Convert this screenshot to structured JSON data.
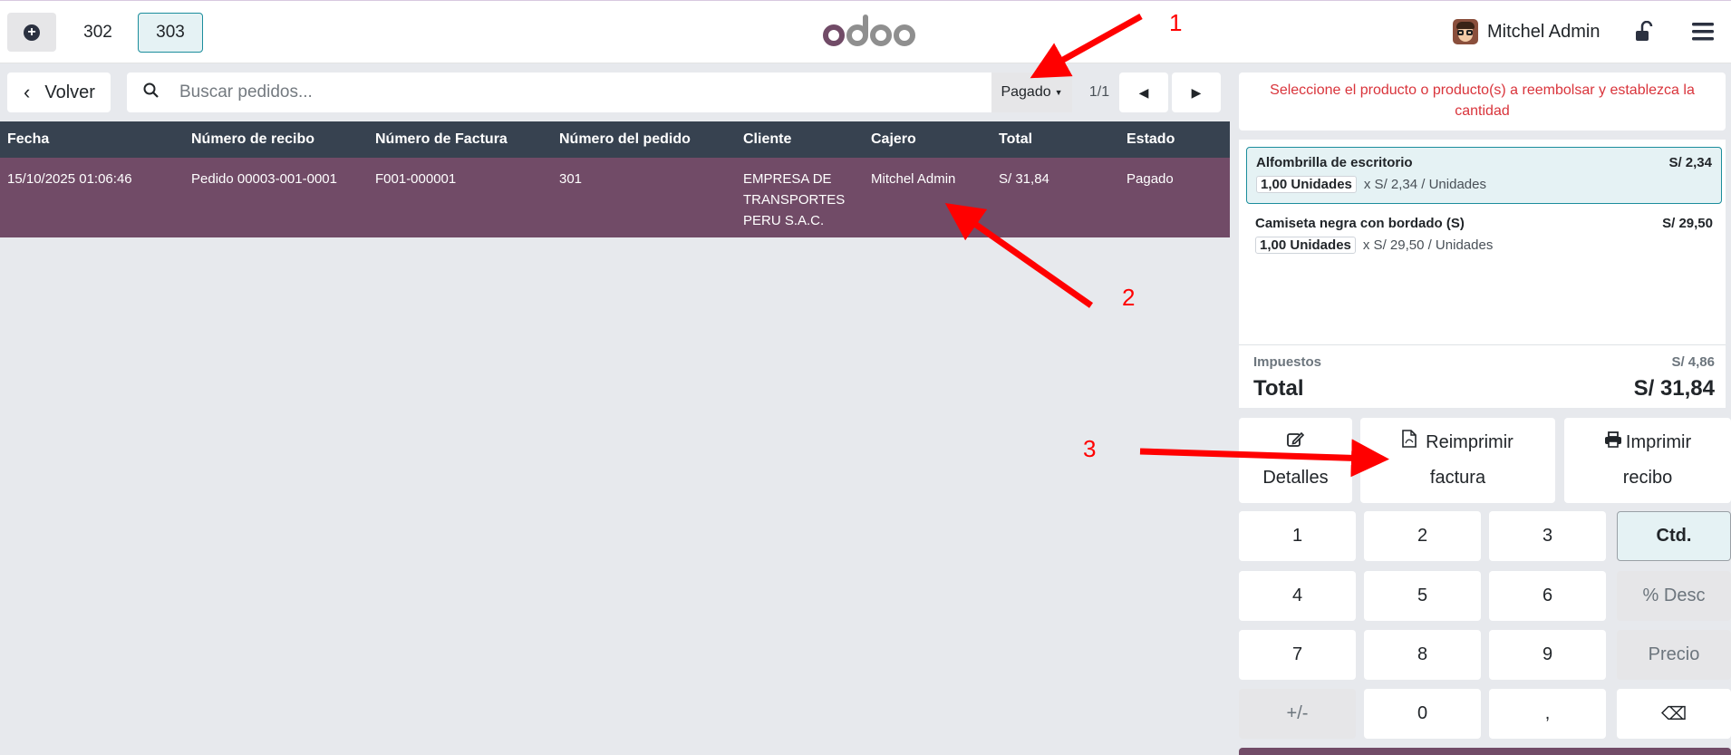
{
  "topbar": {
    "order_tabs": [
      "302",
      "303"
    ],
    "user_name": "Mitchel Admin"
  },
  "toolbar": {
    "back_label": "Volver",
    "search_placeholder": "Buscar pedidos...",
    "filter_label": "Pagado",
    "pager": "1/1"
  },
  "table": {
    "columns": [
      "Fecha",
      "Número de recibo",
      "Número de Factura",
      "Número del pedido",
      "Cliente",
      "Cajero",
      "Total",
      "Estado"
    ],
    "rows": [
      {
        "date": "15/10/2025 01:06:46",
        "receipt": "Pedido 00003-001-0001",
        "invoice": "F001-000001",
        "order": "301",
        "client": "EMPRESA DE TRANSPORTES PERU S.A.C.",
        "cashier": "Mitchel Admin",
        "total": "S/ 31,84",
        "status": "Pagado"
      }
    ]
  },
  "refund": {
    "notice": "Seleccione el producto o producto(s) a reembolsar y establezca la cantidad",
    "lines": [
      {
        "name": "Alfombrilla de escritorio",
        "price": "S/ 2,34",
        "qty": "1,00 Unidades",
        "unit": "x S/ 2,34 / Unidades"
      },
      {
        "name": "Camiseta negra con bordado (S)",
        "price": "S/ 29,50",
        "qty": "1,00 Unidades",
        "unit": "x S/ 29,50 / Unidades"
      }
    ],
    "tax_label": "Impuestos",
    "tax_value": "S/ 4,86",
    "total_label": "Total",
    "total_value": "S/ 31,84"
  },
  "actions": {
    "details": "Detalles",
    "reprint_invoice_1": "Reimprimir",
    "reprint_invoice_2": "factura",
    "print_receipt_1": "Imprimir",
    "print_receipt_2": "recibo"
  },
  "numpad": {
    "keys": [
      "1",
      "2",
      "3",
      "Ctd.",
      "4",
      "5",
      "6",
      "% Desc",
      "7",
      "8",
      "9",
      "Precio",
      "+/-",
      "0",
      ",",
      "⌫"
    ]
  },
  "annotations": [
    "1",
    "2",
    "3"
  ],
  "colors": {
    "brand": "#714b67",
    "header": "#374250",
    "accent": "#1b8d9c",
    "annotation": "#ff0000",
    "notice_text": "#d9343b"
  }
}
